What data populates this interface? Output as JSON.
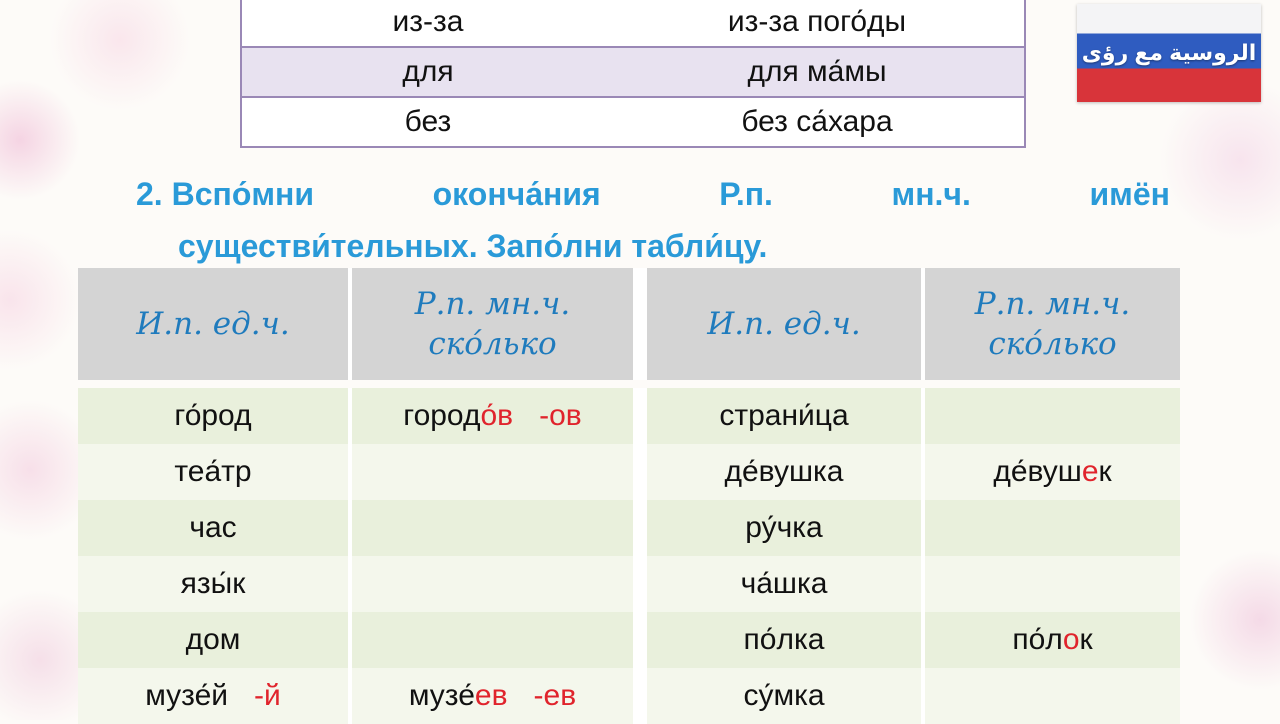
{
  "prepositions": [
    {
      "prep": "из-за",
      "example": "из-за пого́ды",
      "shaded": false
    },
    {
      "prep": "для",
      "example": "для ма́мы",
      "shaded": true
    },
    {
      "prep": "без",
      "example": "без са́хара",
      "shaded": false
    }
  ],
  "badge": {
    "label": "الروسية مع رؤى"
  },
  "task": {
    "line1": [
      "2. Вспо́мни",
      "оконча́ния",
      "Р.п.",
      "мн.ч.",
      "имён"
    ],
    "line2": "существи́тельных. Запо́лни табли́цу."
  },
  "table": {
    "headers": [
      "И.п. ед.ч.",
      "Р.п. мн.ч. ско́лько",
      "И.п. ед.ч.",
      "Р.п. мн.ч. ско́лько"
    ],
    "header_top": "Р.п. мн.ч.",
    "header_stress": "ˊ",
    "header_bottom": "ско́лько",
    "header_left": "И.п. ед.ч.",
    "rows": [
      {
        "l1": "го́род",
        "l2_stem": "город",
        "l2_end": "о́в",
        "l2_hint": "-ов",
        "r1": "страни́ца",
        "r2_stem": "",
        "r2_end": "",
        "r2_tail": ""
      },
      {
        "l1": "теа́тр",
        "l2_stem": "",
        "l2_end": "",
        "l2_hint": "",
        "r1": "де́вушка",
        "r2_stem": "де́вуш",
        "r2_end": "е",
        "r2_tail": "к"
      },
      {
        "l1": "час",
        "l2_stem": "",
        "l2_end": "",
        "l2_hint": "",
        "r1": "ру́чка",
        "r2_stem": "",
        "r2_end": "",
        "r2_tail": ""
      },
      {
        "l1": "язы́к",
        "l2_stem": "",
        "l2_end": "",
        "l2_hint": "",
        "r1": "ча́шка",
        "r2_stem": "",
        "r2_end": "",
        "r2_tail": ""
      },
      {
        "l1": "дом",
        "l2_stem": "",
        "l2_end": "",
        "l2_hint": "",
        "r1": "по́лка",
        "r2_stem": "по́л",
        "r2_end": "о",
        "r2_tail": "к"
      },
      {
        "l1_stem": "музе́й",
        "l1_hint": "-й",
        "l2_stem": "музе́",
        "l2_end": "ев",
        "l2_hint": "-ев",
        "r1": "су́мка",
        "r2_stem": "",
        "r2_end": "",
        "r2_tail": ""
      }
    ]
  }
}
